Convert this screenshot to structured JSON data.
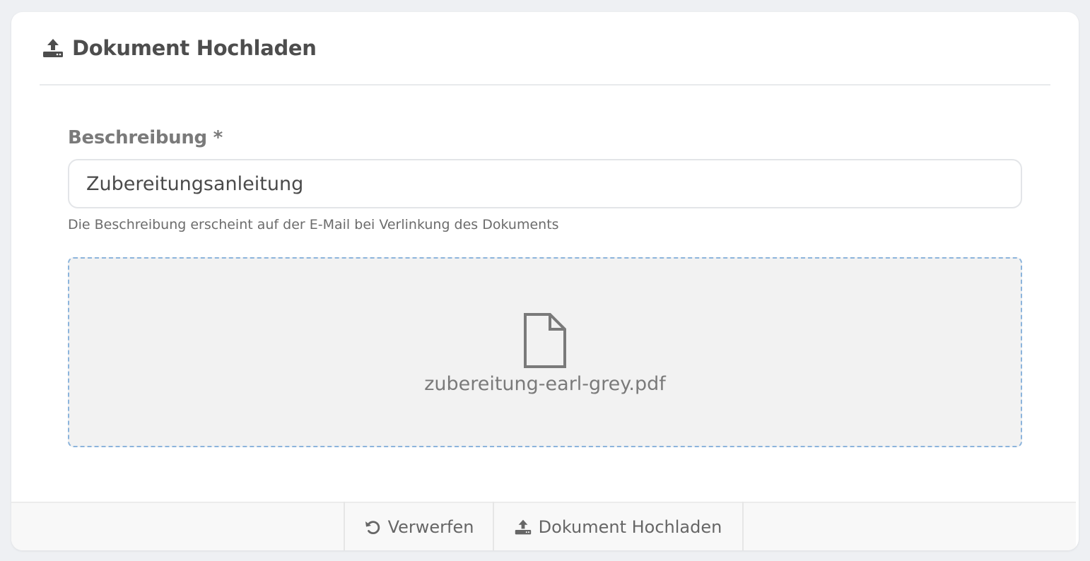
{
  "header": {
    "title": "Dokument Hochladen",
    "icon": "upload-icon"
  },
  "form": {
    "description_label": "Beschreibung *",
    "description_value": "Zubereitungsanleitung",
    "description_help": "Die Beschreibung erscheint auf der E-Mail bei Verlinkung des Dokuments"
  },
  "dropzone": {
    "icon": "file-icon",
    "file_name": "zubereitung-earl-grey.pdf",
    "border_color": "#8cb4dc"
  },
  "footer": {
    "discard_label": "Verwerfen",
    "discard_icon": "undo-icon",
    "upload_label": "Dokument Hochladen",
    "upload_icon": "upload-icon"
  }
}
